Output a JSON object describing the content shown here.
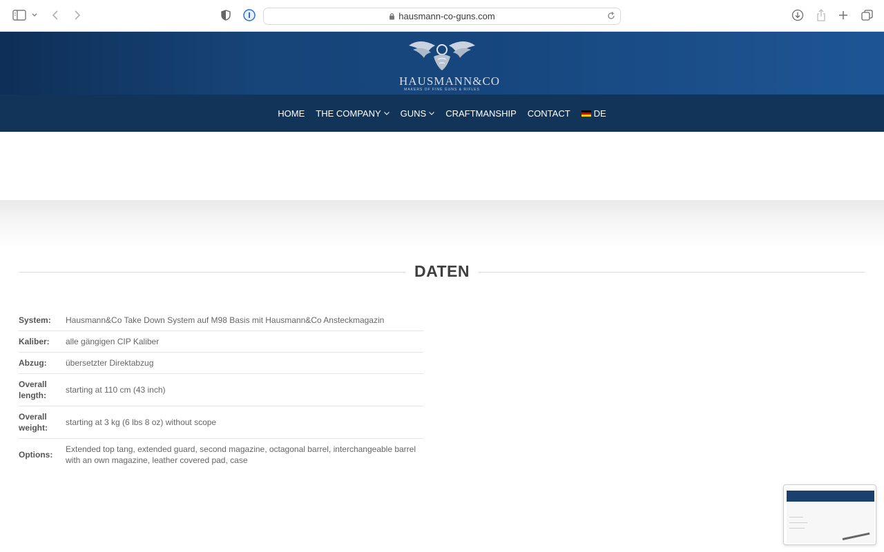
{
  "browser": {
    "url": "hausmann-co-guns.com"
  },
  "logo": {
    "name": "HAUSMANN&CO",
    "tagline": "MAKERS OF FINE GUNS & RIFLES"
  },
  "nav": {
    "items": [
      {
        "label": "HOME"
      },
      {
        "label": "THE COMPANY"
      },
      {
        "label": "GUNS"
      },
      {
        "label": "CRAFTMANSHIP"
      },
      {
        "label": "CONTACT"
      },
      {
        "label": "DE"
      }
    ]
  },
  "section": {
    "title": "DATEN"
  },
  "specs": [
    {
      "key": "System:",
      "value": "Hausmann&Co Take Down System auf M98 Basis mit Hausmann&Co Ansteckmagazin"
    },
    {
      "key": "Kaliber:",
      "value": "alle gängigen CIP Kaliber"
    },
    {
      "key": "Abzug:",
      "value": "übersetzter Direktabzug"
    },
    {
      "key": "Overall length:",
      "value": "starting at 110 cm (43 inch)"
    },
    {
      "key": "Overall weight:",
      "value": "starting at 3 kg (6 lbs 8 oz) without scope"
    },
    {
      "key": "Options:",
      "value": "Extended top tang, extended guard, second magazine, octagonal barrel, interchangeable barrel with an own magazine, leather covered pad, case"
    }
  ],
  "colors": {
    "header": "#17457a",
    "navbar": "#133459",
    "heading": "#3f3f3f"
  }
}
